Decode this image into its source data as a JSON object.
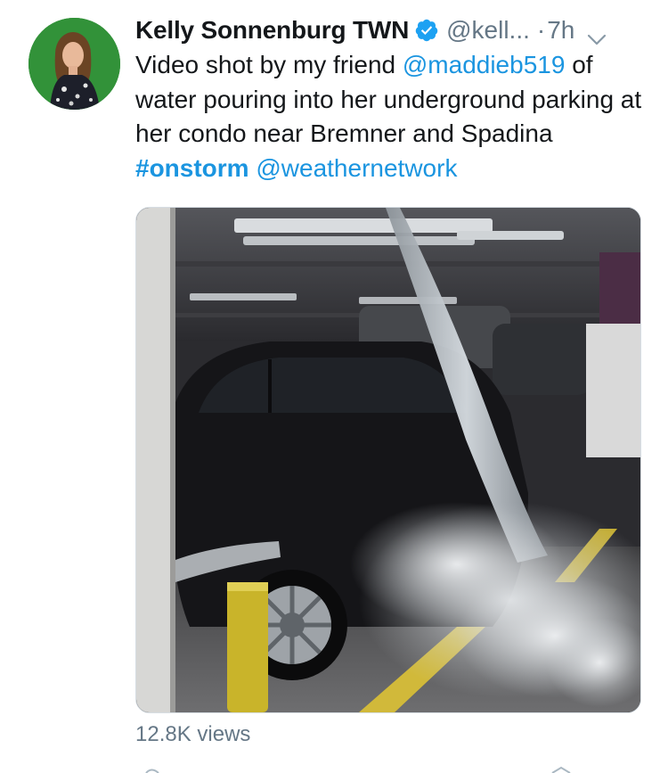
{
  "author": {
    "display_name": "Kelly Sonnenburg TWN",
    "handle": "@kell...",
    "separator": "·",
    "time": "7h",
    "verified": true,
    "avatar_icon": "profile-photo"
  },
  "tweet": {
    "text_1": "Video shot by my friend ",
    "mention_1": "@maddieb519",
    "text_2": " of water pouring into her underground parking at her condo near Bremner and Spadina ",
    "hashtag": "#onstorm",
    "text_3": " ",
    "mention_2": "@weathernetwork"
  },
  "media": {
    "type": "video",
    "description_icon": "video-thumbnail"
  },
  "stats": {
    "views": "12.8K views"
  },
  "colors": {
    "link": "#1b95e0",
    "muted": "#657786",
    "text": "#14171a",
    "verified": "#1da1f2"
  }
}
